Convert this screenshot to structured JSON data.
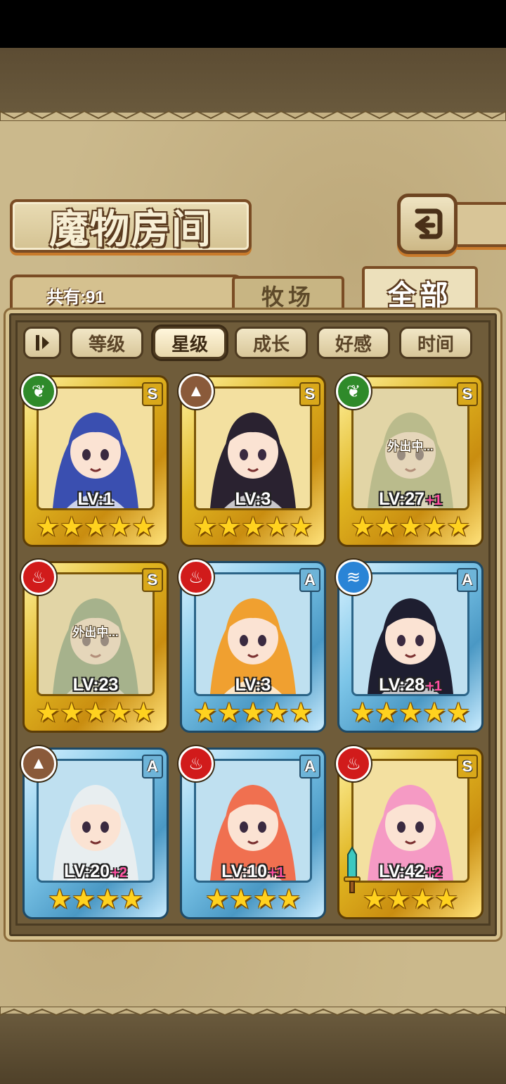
{
  "header": {
    "title": "魔物房间"
  },
  "count": {
    "label": "共有:91"
  },
  "tabs": [
    {
      "label": "牧场",
      "active": false
    },
    {
      "label": "全部",
      "active": true
    }
  ],
  "sort": {
    "buttons": [
      {
        "label": "等级",
        "active": false
      },
      {
        "label": "星级",
        "active": true
      },
      {
        "label": "成长",
        "active": false
      },
      {
        "label": "好感",
        "active": false
      },
      {
        "label": "时间",
        "active": false
      }
    ]
  },
  "cards": [
    {
      "element": "nature-icon",
      "rank": "S",
      "frame": "gold",
      "lv": "LV:1",
      "plus": "",
      "stars": 5,
      "away": "",
      "accent": "#3a4fb0"
    },
    {
      "element": "earth-icon",
      "rank": "S",
      "frame": "gold",
      "lv": "LV:3",
      "plus": "",
      "stars": 5,
      "away": "",
      "accent": "#2a2230"
    },
    {
      "element": "nature-icon",
      "rank": "S",
      "frame": "gold",
      "lv": "LV:27",
      "plus": "+1",
      "stars": 5,
      "away": "外出中...",
      "accent": "#8fa060"
    },
    {
      "element": "fire-icon",
      "rank": "S",
      "frame": "gold",
      "lv": "LV:23",
      "plus": "",
      "stars": 5,
      "away": "外出中...",
      "accent": "#5e8a60"
    },
    {
      "element": "fire-icon",
      "rank": "A",
      "frame": "blue",
      "lv": "LV:3",
      "plus": "",
      "stars": 5,
      "away": "",
      "accent": "#f0a030"
    },
    {
      "element": "water-icon",
      "rank": "A",
      "frame": "blue",
      "lv": "LV:28",
      "plus": "+1",
      "stars": 5,
      "away": "",
      "accent": "#1e1e30"
    },
    {
      "element": "earth-icon",
      "rank": "A",
      "frame": "blue",
      "lv": "LV:20",
      "plus": "+2",
      "stars": 4,
      "away": "",
      "accent": "#e8eef0"
    },
    {
      "element": "fire-icon",
      "rank": "A",
      "frame": "blue",
      "lv": "LV:10",
      "plus": "+1",
      "stars": 4,
      "away": "",
      "accent": "#f07050"
    },
    {
      "element": "fire-icon",
      "rank": "S",
      "frame": "gold",
      "lv": "LV:42",
      "plus": "+2",
      "stars": 4,
      "away": "",
      "accent": "#f59ac4"
    }
  ]
}
